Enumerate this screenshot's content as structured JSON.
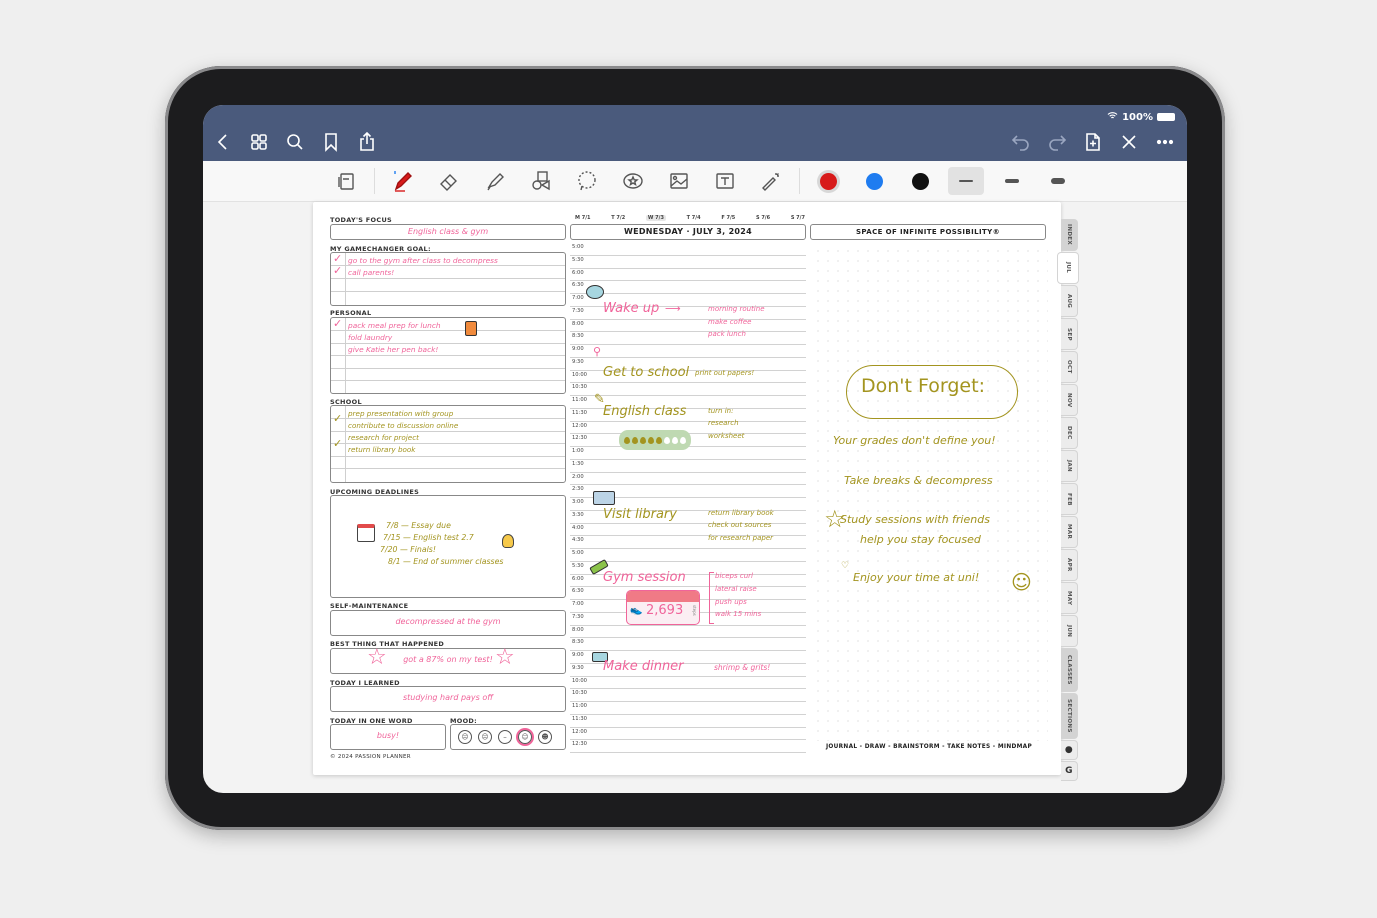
{
  "status_bar": {
    "battery": "100%"
  },
  "nav": {
    "left": [
      {
        "name": "back-icon"
      },
      {
        "name": "grid-view-icon"
      },
      {
        "name": "search-icon"
      },
      {
        "name": "bookmark-icon"
      },
      {
        "name": "share-icon"
      }
    ],
    "right": [
      {
        "name": "undo-icon"
      },
      {
        "name": "redo-icon"
      },
      {
        "name": "add-page-icon"
      },
      {
        "name": "close-icon"
      },
      {
        "name": "more-icon"
      }
    ]
  },
  "toolbar": {
    "tools": [
      "pages-tool",
      "pen-tool",
      "eraser-tool",
      "highlighter-tool",
      "shapes-tool",
      "lasso-tool",
      "sticker-tool",
      "image-tool",
      "text-tool",
      "laser-pointer-tool"
    ],
    "colors": [
      {
        "name": "red",
        "hex": "#d71a1a",
        "selected": true
      },
      {
        "name": "blue",
        "hex": "#1f7cf0",
        "selected": false
      },
      {
        "name": "black",
        "hex": "#111111",
        "selected": false
      }
    ],
    "thickness": [
      {
        "name": "thin",
        "selected": true
      },
      {
        "name": "medium",
        "selected": false
      },
      {
        "name": "thick",
        "selected": false
      }
    ]
  },
  "planner": {
    "todays_focus": {
      "label": "TODAY'S FOCUS",
      "value": "English class & gym"
    },
    "gamechanger": {
      "label": "MY GAMECHANGER GOAL:",
      "items": [
        "go to the gym after class to decompress",
        "call parents!"
      ]
    },
    "personal": {
      "label": "PERSONAL",
      "items": [
        "pack meal prep for lunch",
        "fold laundry",
        "give Katie her pen back!"
      ]
    },
    "school": {
      "label": "SCHOOL",
      "items": [
        "prep presentation with group",
        "contribute to discussion online",
        "research for project",
        "return library book"
      ]
    },
    "deadlines": {
      "label": "UPCOMING DEADLINES",
      "items": [
        "7/8 — Essay due",
        "7/15 — English test 2.7",
        "7/20 — Finals!",
        "8/1 — End of summer classes"
      ]
    },
    "self_maintenance": {
      "label": "SELF-MAINTENANCE",
      "value": "decompressed at the gym"
    },
    "best_thing": {
      "label": "BEST THING THAT HAPPENED",
      "value": "got a 87% on my test!"
    },
    "learned": {
      "label": "TODAY I LEARNED",
      "value": "studying hard pays off"
    },
    "one_word": {
      "label": "TODAY IN ONE WORD",
      "value": "busy!"
    },
    "mood": {
      "label": "MOOD:",
      "faces": [
        "very-sad",
        "sad",
        "neutral",
        "happy",
        "very-happy"
      ],
      "selected_index": 3
    },
    "copyright": "© 2024 PASSION PLANNER",
    "week_days": [
      "M 7/1",
      "T 7/2",
      "W 7/3",
      "T 7/4",
      "F 7/5",
      "S 7/6",
      "S 7/7"
    ],
    "selected_day_index": 2,
    "date_title": "WEDNESDAY · JULY 3, 2024",
    "times": [
      "5:00",
      "5:30",
      "6:00",
      "6:30",
      "7:00",
      "7:30",
      "8:00",
      "8:30",
      "9:00",
      "9:30",
      "10:00",
      "10:30",
      "11:00",
      "11:30",
      "12:00",
      "12:30",
      "1:00",
      "1:30",
      "2:00",
      "2:30",
      "3:00",
      "3:30",
      "4:00",
      "4:30",
      "5:00",
      "5:30",
      "6:00",
      "6:30",
      "7:00",
      "7:30",
      "8:00",
      "8:30",
      "9:00",
      "9:30",
      "10:00",
      "10:30",
      "11:00",
      "11:30",
      "12:00",
      "12:30"
    ],
    "events": {
      "wake": {
        "title": "Wake up",
        "items": [
          "morning routine",
          "make coffee",
          "pack lunch"
        ]
      },
      "school": {
        "title": "Get to school",
        "items": [
          "print out papers!"
        ]
      },
      "english": {
        "title": "English class",
        "items": [
          "turn in:",
          "research",
          "worksheet"
        ],
        "water_filled": 5,
        "water_total": 8
      },
      "library": {
        "title": "Visit library",
        "items": [
          "return library book",
          "check out sources",
          "for research paper"
        ]
      },
      "gym": {
        "title": "Gym session",
        "items": [
          "biceps curl",
          "lateral raise",
          "push ups",
          "walk 15 mins"
        ],
        "steps": "2,693",
        "steps_unit": "steps"
      },
      "dinner": {
        "title": "Make dinner",
        "note": "shrimp & grits!"
      }
    },
    "space_title": "SPACE OF INFINITE POSSIBILITY®",
    "dont_forget": {
      "title": "Don't Forget:",
      "lines": [
        "Your grades don't define you!",
        "Take breaks & decompress",
        "Study sessions with friends",
        "help you stay focused",
        "Enjoy your time at uni!"
      ]
    },
    "footer_tagline": "JOURNAL - DRAW - BRAINSTORM - TAKE NOTES - MINDMAP",
    "tabs": [
      "INDEX",
      "JUL",
      "AUG",
      "SEP",
      "OCT",
      "NOV",
      "DEC",
      "JAN",
      "FEB",
      "MAR",
      "APR",
      "MAY",
      "JUN",
      "CLASSES",
      "SECTIONS"
    ],
    "selected_tab": "JUL"
  },
  "colors": {
    "header": "#4a5a7c",
    "pink_ink": "#f0649a",
    "olive_ink": "#a3941f"
  }
}
